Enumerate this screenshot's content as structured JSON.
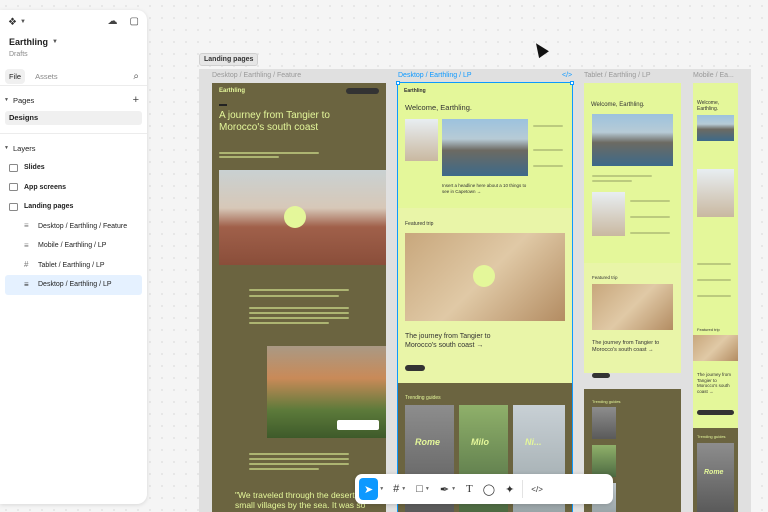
{
  "sidebar": {
    "project_name": "Earthling",
    "project_location": "Drafts",
    "tabs": [
      {
        "label": "File"
      },
      {
        "label": "Assets"
      }
    ],
    "pages_title": "Pages",
    "pages": [
      {
        "label": "Designs"
      }
    ],
    "layers_title": "Layers",
    "layers": [
      {
        "label": "Slides"
      },
      {
        "label": "App screens"
      },
      {
        "label": "Landing pages"
      }
    ],
    "children": [
      {
        "label": "Desktop / Earthling / Feature",
        "icon": "lines-icon"
      },
      {
        "label": "Mobile / Earthling / LP",
        "icon": "lines-icon"
      },
      {
        "label": "Tablet / Earthling / LP",
        "icon": "grid-icon"
      },
      {
        "label": "Desktop / Earthling / LP",
        "icon": "lines-icon"
      }
    ]
  },
  "canvas": {
    "section_label": "Landing pages",
    "frame_labels": [
      "Desktop / Earthling / Feature",
      "Desktop / Earthling / LP",
      "Tablet / Earthling / LP",
      "Mobile / Ea..."
    ],
    "code_badge": "</>",
    "feature": {
      "brand": "Earthling",
      "headline": "A journey from Tangier to Morocco's south coast",
      "quote": "\"We traveled through the desert to small villages by the sea. It was so stunning—"
    },
    "lp": {
      "brand": "Earthling",
      "welcome": "Welcome, Earthling.",
      "headline_link": "Insert a headline here about a 10 things to see in Capetown →",
      "featured": "Featured trip",
      "trip_title": "The journey from Tangier to Morocco's south coast →",
      "guides": "Trending guides",
      "guide_cards": [
        "Rome",
        "Milo",
        "Ni..."
      ]
    },
    "tablet": {
      "welcome": "Welcome, Earthling.",
      "featured": "Featured trip",
      "trip_title": "The journey from Tangier to Morocco's south coast →",
      "guides": "Trending guides"
    },
    "mobile": {
      "welcome": "Welcome, Earthling.",
      "featured": "Featured trip",
      "trip_title": "The journey from Tangier to Morocco's south coast →",
      "guides": "Trending guides",
      "guide_card": "Rome"
    }
  },
  "toolbar": {
    "tools": [
      "move-tool",
      "frame-tool",
      "rectangle-tool",
      "pen-tool",
      "text-tool",
      "comment-tool",
      "actions-tool",
      "dev-mode-toggle"
    ],
    "active_tool": "move-tool",
    "dev_label": "</>"
  },
  "colors": {
    "accent": "#0d99ff",
    "olive": "#6b6440",
    "lime": "#e4f79a"
  }
}
